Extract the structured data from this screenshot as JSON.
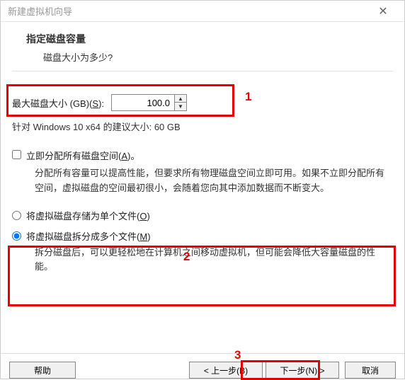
{
  "title": "新建虚拟机向导",
  "heading": "指定磁盘容量",
  "subheading": "磁盘大小为多少?",
  "size_label_pre": "最大磁盘大小 (GB)(",
  "size_label_key": "S",
  "size_label_post": "):",
  "size_value": "100.0",
  "recommend": "针对 Windows 10 x64 的建议大小: 60 GB",
  "alloc_now_pre": "立即分配所有磁盘空间(",
  "alloc_now_key": "A",
  "alloc_now_post": ")。",
  "alloc_desc": "分配所有容量可以提高性能，但要求所有物理磁盘空间立即可用。如果不立即分配所有空间，虚拟磁盘的空间最初很小，会随着您向其中添加数据而不断变大。",
  "single_pre": "将虚拟磁盘存储为单个文件(",
  "single_key": "O",
  "single_post": ")",
  "multi_pre": "将虚拟磁盘拆分成多个文件(",
  "multi_key": "M",
  "multi_post": ")",
  "multi_desc": "拆分磁盘后，可以更轻松地在计算机之间移动虚拟机，但可能会降低大容量磁盘的性能。",
  "help": "帮助",
  "back": "< 上一步(B)",
  "next": "下一步(N) >",
  "cancel": "取消",
  "anno1": "1",
  "anno2": "2",
  "anno3": "3"
}
